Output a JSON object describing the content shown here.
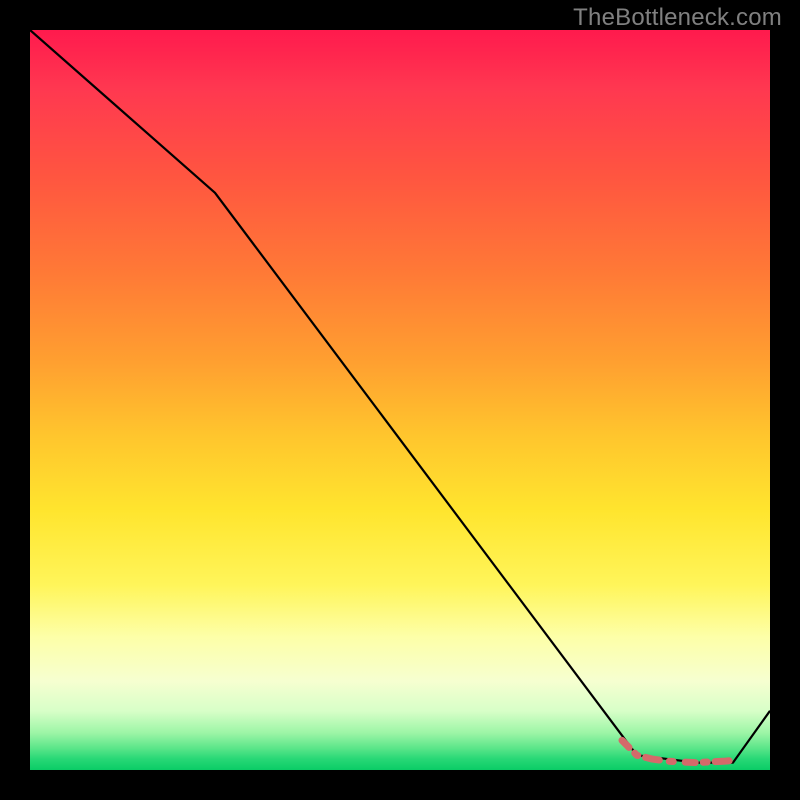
{
  "watermark": "TheBottleneck.com",
  "chart_data": {
    "type": "line",
    "title": "",
    "xlabel": "",
    "ylabel": "",
    "xlim": [
      0,
      100
    ],
    "ylim": [
      0,
      100
    ],
    "gradient_meaning": "vertical red-to-green heat background (bottleneck severity)",
    "series": [
      {
        "name": "bottleneck-curve",
        "color": "#000000",
        "x": [
          0,
          25,
          82,
          90,
          95,
          100
        ],
        "values": [
          100,
          78,
          2,
          1,
          1,
          8
        ]
      }
    ],
    "highlight": {
      "name": "optimal-range",
      "color": "#d46a6a",
      "x": [
        80,
        82,
        84,
        86,
        88,
        90,
        94,
        95
      ],
      "values": [
        4,
        2,
        1.5,
        1.2,
        1.1,
        1,
        1.2,
        1.3
      ]
    }
  }
}
